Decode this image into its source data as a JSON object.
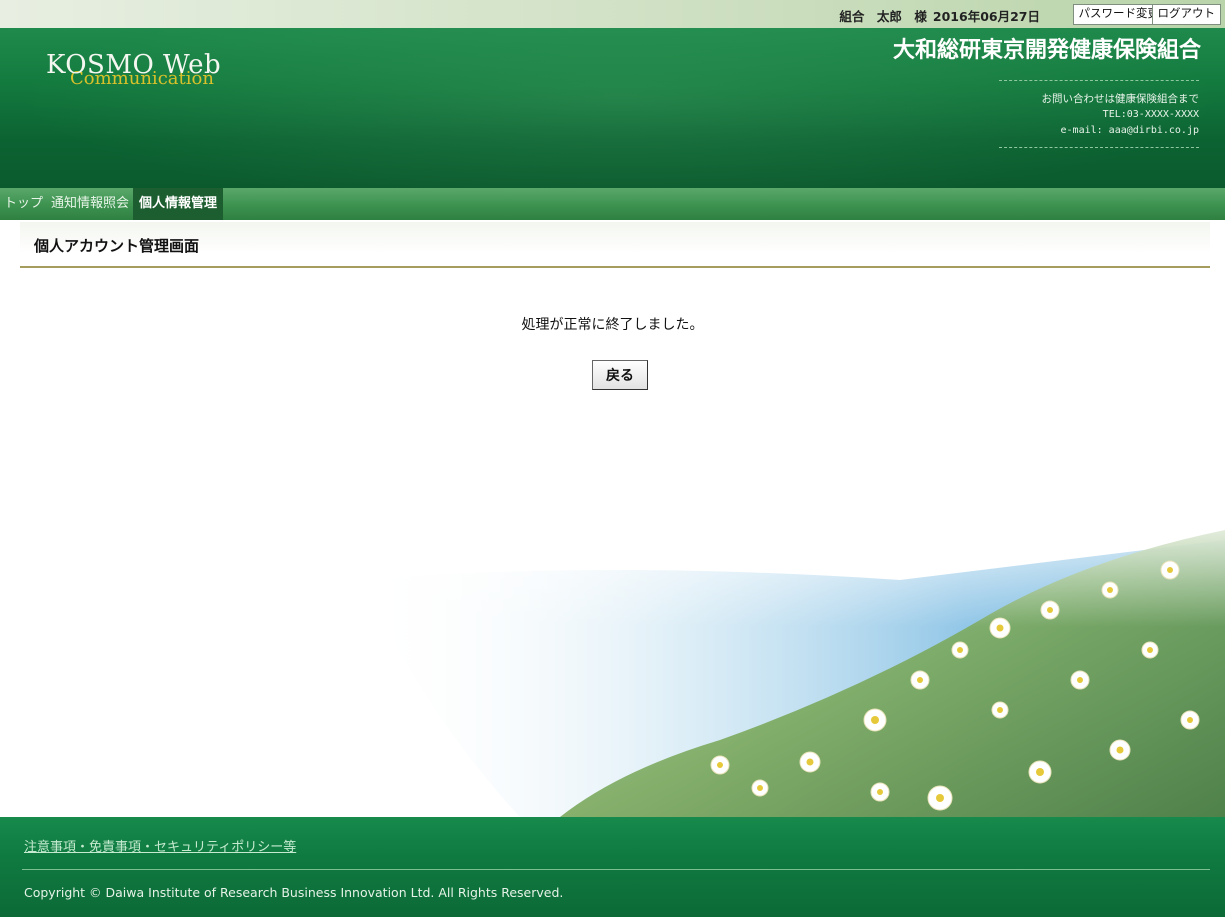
{
  "top_bar": {
    "user": "組合　太郎　様",
    "date": "2016年06月27日",
    "password_change": "パスワード変更",
    "logout": "ログアウト"
  },
  "header": {
    "logo_main": "KOSMO Web",
    "logo_sub": "Communication",
    "org_name": "大和総研東京開発健康保険組合",
    "contact_note": "お問い合わせは健康保険組合まで",
    "tel": "TEL:03-XXXX-XXXX",
    "email": "e-mail: aaa@dirbi.co.jp"
  },
  "nav": {
    "items": [
      {
        "label": "トップ"
      },
      {
        "label": "通知情報照会"
      },
      {
        "label": "個人情報管理"
      }
    ],
    "active_index": 2
  },
  "page": {
    "title": "個人アカウント管理画面",
    "message": "処理が正常に終了しました。",
    "back_button": "戻る"
  },
  "footer": {
    "link": "注意事項・免責事項・セキュリティポリシー等",
    "copyright": "Copyright © Daiwa Institute of Research Business Innovation Ltd. All Rights Reserved."
  },
  "colors": {
    "header_green": "#137a3e",
    "nav_green": "#3f9452",
    "nav_active": "#1c5e2f",
    "title_rule": "#a59d5e",
    "logo_gold": "#d8c12a"
  }
}
